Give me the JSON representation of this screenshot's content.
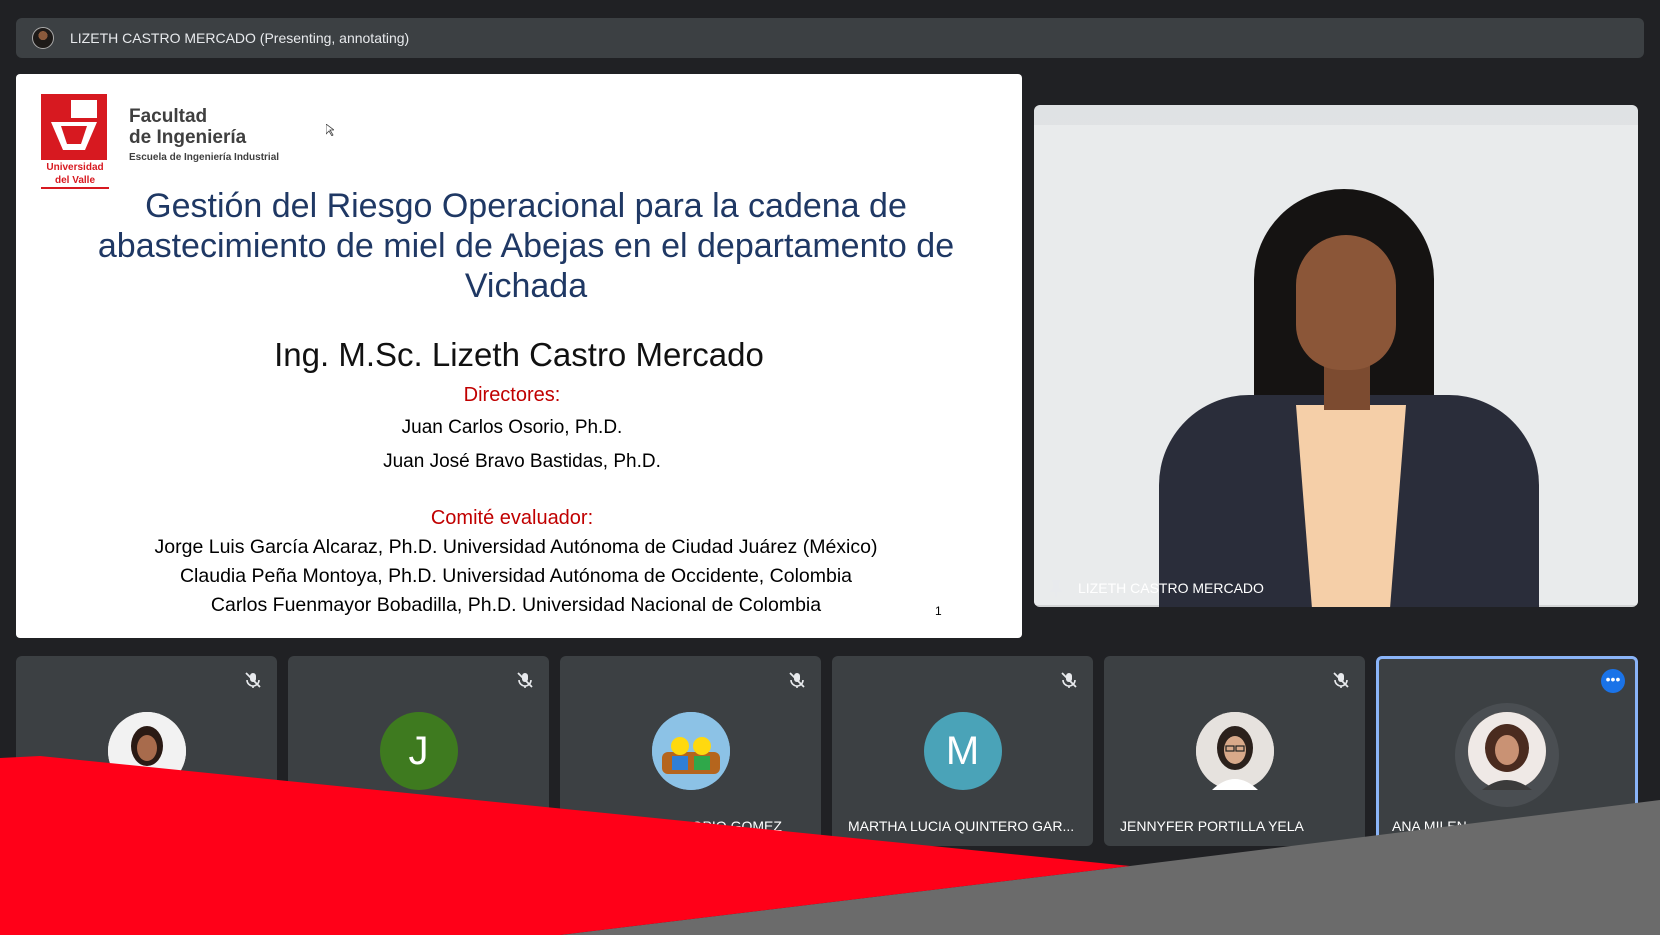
{
  "topbar": {
    "title": "LIZETH CASTRO MERCADO (Presenting, annotating)"
  },
  "slide": {
    "logo_text_1": "Universidad",
    "logo_text_2": "del Valle",
    "faculty_1": "Facultad",
    "faculty_2": "de Ingeniería",
    "school": "Escuela de Ingeniería Industrial",
    "title_line_1": "Gestión del Riesgo Operacional para la cadena de",
    "title_line_2": "abastecimiento de miel de Abejas en el departamento de",
    "title_line_3": "Vichada",
    "presenter": "Ing. M.Sc. Lizeth Castro Mercado",
    "directors_heading": "Directores:",
    "director_1": "Juan Carlos Osorio, Ph.D.",
    "director_2": "Juan José Bravo Bastidas, Ph.D.",
    "committee_heading": "Comité evaluador:",
    "committee_1": "Jorge Luis García Alcaraz, Ph.D. Universidad Autónoma de Ciudad Juárez (México)",
    "committee_2": "Claudia Peña Montoya, Ph.D. Universidad Autónoma de Occidente, Colombia",
    "committee_3": "Carlos Fuenmayor Bobadilla, Ph.D. Universidad Nacional de Colombia",
    "page_number": "1"
  },
  "presenter_video": {
    "name": "LIZETH CASTRO MERCADO"
  },
  "participants": [
    {
      "name": "",
      "initial": "",
      "avatar_color": "#f0f0f0",
      "mic_icon": "mic-off-icon"
    },
    {
      "name": "",
      "initial": "J",
      "avatar_color": "#3e7a1f",
      "mic_icon": "mic-off-icon"
    },
    {
      "name": "...OPIO GOMEZ",
      "initial": "",
      "avatar_color": "#7bb0d8",
      "mic_icon": "mic-off-icon"
    },
    {
      "name": "MARTHA LUCIA QUINTERO GAR...",
      "initial": "M",
      "avatar_color": "#4aa3b8",
      "mic_icon": "mic-off-icon"
    },
    {
      "name": "JENNYFER PORTILLA YELA",
      "initial": "",
      "avatar_color": "#d9d4cf",
      "mic_icon": "mic-off-icon"
    },
    {
      "name": "ANA MILEN...",
      "initial": "",
      "avatar_color": "#6d4c3d",
      "mic_icon": "more-options-icon"
    }
  ],
  "colors": {
    "background": "#202124",
    "tile": "#3c4043",
    "accent_blue": "#1a73e8",
    "slide_title": "#1f3864",
    "slide_red": "#c00000",
    "overlay_red": "#ff0018",
    "overlay_gray": "#6b6b6b"
  }
}
